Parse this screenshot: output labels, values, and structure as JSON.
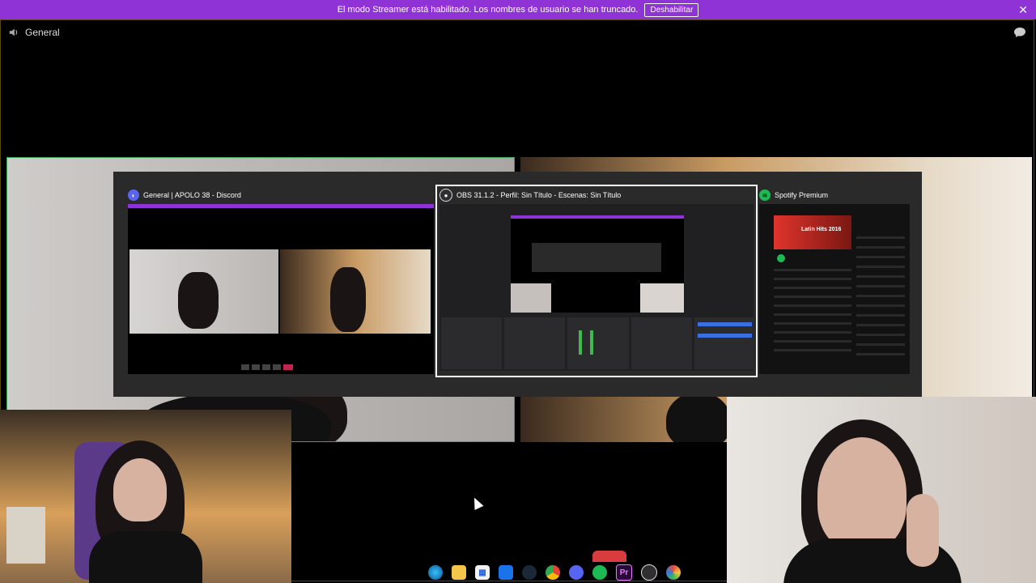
{
  "banner": {
    "message": "El modo Streamer está habilitado. Los nombres de usuario se han truncado.",
    "button_label": "Deshabilitar",
    "close_icon": "close-icon",
    "color": "#8f32d6"
  },
  "channel": {
    "name": "General",
    "icon": "speaker-icon",
    "chat_icon": "chat-bubble-icon"
  },
  "alt_tab": {
    "windows": [
      {
        "title": "General | APOLO 38 - Discord",
        "icon": "discord-icon",
        "accent": "#5865f2"
      },
      {
        "title": "OBS 31.1.2 - Perfil: Sin Título - Escenas: Sin Título",
        "icon": "obs-icon",
        "accent": "#302e31"
      },
      {
        "title": "Spotify Premium",
        "icon": "spotify-icon",
        "accent": "#1db954"
      }
    ],
    "spotify_playlist": "Latin Hits 2016"
  },
  "speaking_color": "#3ba55d",
  "taskbar": {
    "icons": [
      "edge-icon",
      "file-explorer-icon",
      "store-icon",
      "outlook-icon",
      "steam-icon",
      "chrome-icon",
      "discord-icon",
      "spotify-icon",
      "premiere-icon",
      "obs-icon",
      "app-icon"
    ],
    "labels": {
      "premiere": "Pr"
    }
  }
}
